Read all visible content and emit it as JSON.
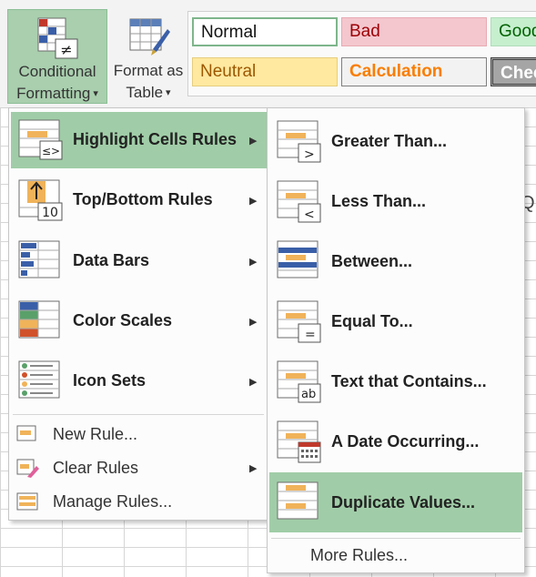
{
  "ribbon": {
    "conditional_formatting": {
      "line1": "Conditional",
      "line2": "Formatting"
    },
    "format_as_table": {
      "line1": "Format as",
      "line2": "Table"
    },
    "caret": "▾",
    "styles": [
      {
        "label": "Normal",
        "bg": "#ffffff",
        "fg": "#111111",
        "border": "#7fb58b"
      },
      {
        "label": "Bad",
        "bg": "#f4c7ce",
        "fg": "#9c0006",
        "border": "#e8aab3"
      },
      {
        "label": "Good",
        "bg": "#c6efce",
        "fg": "#006100",
        "border": "#b0dcb8"
      },
      {
        "label": "Neutral",
        "bg": "#ffe9a0",
        "fg": "#9c5700",
        "border": "#e6cd80"
      },
      {
        "label": "Calculation",
        "bg": "#f2f2f2",
        "fg": "#fa7d00",
        "border": "#7f7f7f"
      },
      {
        "label": "Check Cell",
        "bg": "#a5a5a5",
        "fg": "#ffffff",
        "border": "#3f3f3f"
      }
    ]
  },
  "sheet": {
    "visible_column_letter": "Q"
  },
  "main_menu": {
    "items": [
      {
        "label": "Highlight Cells Rules",
        "selected": true,
        "has_submenu": true,
        "icon": "highlight-cells-icon"
      },
      {
        "label": "Top/Bottom Rules",
        "selected": false,
        "has_submenu": true,
        "icon": "top-bottom-icon"
      },
      {
        "label": "Data Bars",
        "selected": false,
        "has_submenu": true,
        "icon": "data-bars-icon"
      },
      {
        "label": "Color Scales",
        "selected": false,
        "has_submenu": true,
        "icon": "color-scales-icon"
      },
      {
        "label": "Icon Sets",
        "selected": false,
        "has_submenu": true,
        "icon": "icon-sets-icon"
      }
    ],
    "small_items": [
      {
        "label": "New Rule...",
        "has_submenu": false,
        "icon": "new-rule-icon"
      },
      {
        "label": "Clear Rules",
        "has_submenu": true,
        "icon": "clear-rules-icon"
      },
      {
        "label": "Manage Rules...",
        "has_submenu": false,
        "icon": "manage-rules-icon"
      }
    ],
    "submenu_arrow": "▶"
  },
  "submenu": {
    "items": [
      {
        "label": "Greater Than...",
        "badge": ">",
        "selected": false
      },
      {
        "label": "Less Than...",
        "badge": "<",
        "selected": false
      },
      {
        "label": "Between...",
        "badge": "",
        "selected": false
      },
      {
        "label": "Equal To...",
        "badge": "=",
        "selected": false
      },
      {
        "label": "Text that Contains...",
        "badge": "ab",
        "selected": false
      },
      {
        "label": "A Date Occurring...",
        "badge": "",
        "selected": false
      },
      {
        "label": "Duplicate Values...",
        "badge": "",
        "selected": true
      }
    ],
    "more_rules": "More Rules..."
  },
  "colors": {
    "selection": "#a0cda7",
    "accent_orange": "#f0b35a",
    "icon_blue": "#3a5fa8"
  }
}
